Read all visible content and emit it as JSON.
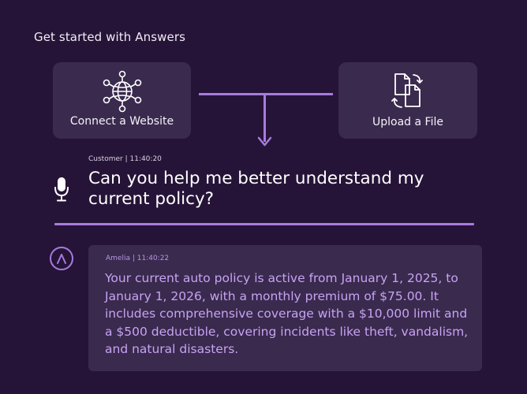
{
  "heading": "Get started with Answers",
  "cards": {
    "website": {
      "label": "Connect a Website",
      "icon": "network-globe-icon"
    },
    "file": {
      "label": "Upload a File",
      "icon": "file-transfer-icon"
    }
  },
  "conversation": {
    "customer": {
      "meta": "Customer | 11:40:20",
      "message": "Can you help me better understand my current policy?",
      "icon": "microphone-icon"
    },
    "agent": {
      "meta": "Amelia | 11:40:22",
      "message": "Your current auto policy is active from January 1, 2025, to January 1, 2026, with a monthly premium of $75.00. It includes comprehensive coverage with a $10,000 limit and a $500 deductible, covering incidents like theft, vandalism, and natural disasters.",
      "icon": "amelia-logo-icon"
    }
  },
  "colors": {
    "background": "#261438",
    "card": "#3a2a4e",
    "accent": "#a77bdf",
    "agent_text": "#c7a3f2"
  }
}
